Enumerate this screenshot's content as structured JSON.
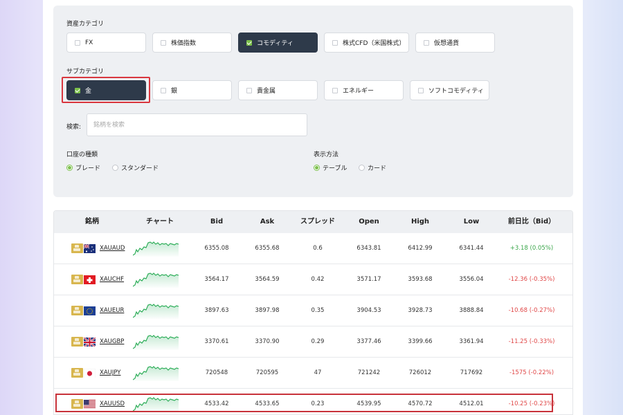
{
  "filters": {
    "asset_label": "資産カテゴリ",
    "asset_categories": [
      {
        "label": "FX",
        "checked": false
      },
      {
        "label": "株価指数",
        "checked": false
      },
      {
        "label": "コモディティ",
        "checked": true
      },
      {
        "label": "株式CFD（米国株式）",
        "checked": false
      },
      {
        "label": "仮想通貨",
        "checked": false
      }
    ],
    "sub_label": "サブカテゴリ",
    "sub_categories": [
      {
        "label": "金",
        "checked": true
      },
      {
        "label": "銀",
        "checked": false
      },
      {
        "label": "貴金属",
        "checked": false
      },
      {
        "label": "エネルギー",
        "checked": false
      },
      {
        "label": "ソフトコモディティ",
        "checked": false
      }
    ],
    "search_label": "検索:",
    "search_placeholder": "銘柄を検索",
    "account_label": "口座の種類",
    "account_options": [
      "ブレード",
      "スタンダード"
    ],
    "display_label": "表示方法",
    "display_options": [
      "テーブル",
      "カード"
    ]
  },
  "table": {
    "headers": [
      "銘柄",
      "チャート",
      "Bid",
      "Ask",
      "スプレッド",
      "Open",
      "High",
      "Low",
      "前日比（Bid）"
    ],
    "rows": [
      {
        "symbol": "XAUAUD",
        "flag": "australia-flag-icon",
        "bid": "6355.08",
        "ask": "6355.68",
        "spread": "0.6",
        "open": "6343.81",
        "high": "6412.99",
        "low": "6341.44",
        "change": "+3.18 (0.05%)",
        "trend": "up"
      },
      {
        "symbol": "XAUCHF",
        "flag": "switzerland-flag-icon",
        "bid": "3564.17",
        "ask": "3564.59",
        "spread": "0.42",
        "open": "3571.17",
        "high": "3593.68",
        "low": "3556.04",
        "change": "-12.36 (-0.35%)",
        "trend": "down"
      },
      {
        "symbol": "XAUEUR",
        "flag": "eu-flag-icon",
        "bid": "3897.63",
        "ask": "3897.98",
        "spread": "0.35",
        "open": "3904.53",
        "high": "3928.73",
        "low": "3888.84",
        "change": "-10.68 (-0.27%)",
        "trend": "down"
      },
      {
        "symbol": "XAUGBP",
        "flag": "uk-flag-icon",
        "bid": "3370.61",
        "ask": "3370.90",
        "spread": "0.29",
        "open": "3377.46",
        "high": "3399.66",
        "low": "3361.94",
        "change": "-11.25 (-0.33%)",
        "trend": "down"
      },
      {
        "symbol": "XAUJPY",
        "flag": "japan-flag-icon",
        "bid": "720548",
        "ask": "720595",
        "spread": "47",
        "open": "721242",
        "high": "726012",
        "low": "717692",
        "change": "-1575 (-0.22%)",
        "trend": "down"
      },
      {
        "symbol": "XAUUSD",
        "flag": "us-flag-icon",
        "bid": "4533.42",
        "ask": "4533.65",
        "spread": "0.23",
        "open": "4539.95",
        "high": "4570.72",
        "low": "4512.01",
        "change": "-10.25 (-0.23%)",
        "trend": "down"
      }
    ]
  },
  "colors": {
    "positive": "#3aa64a",
    "negative": "#e04848",
    "accent": "#7cc04b",
    "active_chip": "#2e3a4a",
    "highlight": "#d9363e"
  }
}
